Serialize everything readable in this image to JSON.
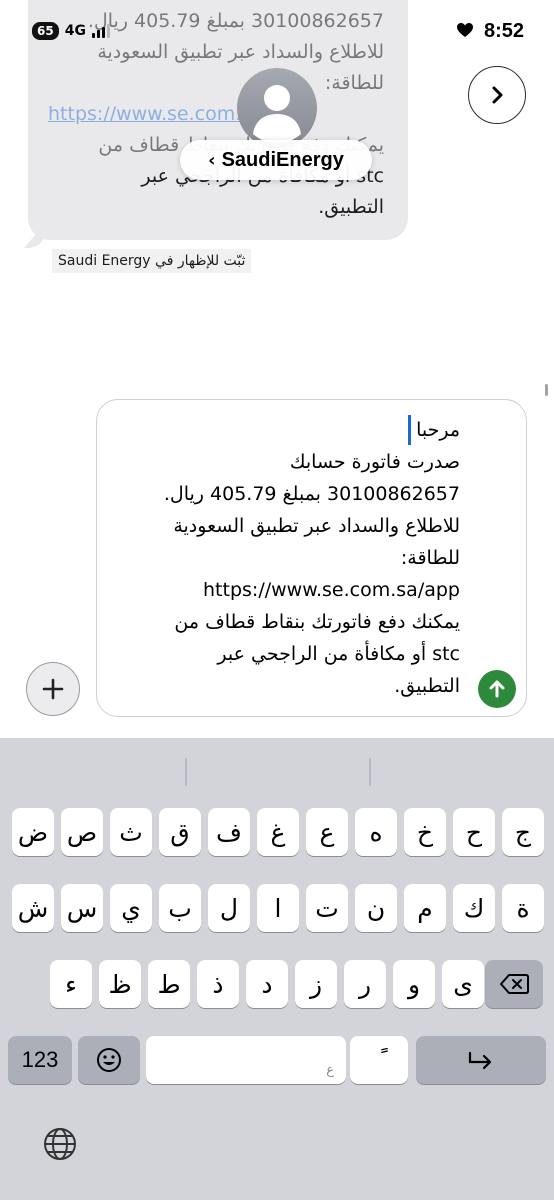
{
  "status": {
    "badge": "65",
    "network": "4G",
    "time": "8:52"
  },
  "received": {
    "lines": [
      "30100862657 بمبلغ 405.79 ريال.",
      "للاطلاع والسداد عبر تطبيق السعودية",
      "للطاقة:",
      "https://www.se.com.sa/app",
      "يمكنك دفع فاتورتك بنقاط قطاف من",
      "stc أو مكافأة من الراجحي عبر",
      "التطبيق."
    ]
  },
  "header": {
    "contact_name": "SaudiEnergy",
    "back_chevron": "‹"
  },
  "pin_caption": "ثبّت للإظهار في Saudi Energy",
  "compose": {
    "lines": [
      "مرحبا",
      "صدرت فاتورة حسابك",
      "30100862657 بمبلغ 405.79 ريال.",
      "للاطلاع والسداد عبر تطبيق السعودية",
      "للطاقة:",
      "https://www.se.com.sa/app",
      "يمكنك دفع فاتورتك بنقاط قطاف من",
      "stc أو مكافأة من الراجحي عبر",
      "التطبيق."
    ],
    "plus_label": "+"
  },
  "keyboard": {
    "row1": [
      "ج",
      "ح",
      "خ",
      "ه",
      "ع",
      "غ",
      "ف",
      "ق",
      "ث",
      "ص",
      "ض"
    ],
    "row2": [
      "ة",
      "ك",
      "م",
      "ن",
      "ت",
      "ا",
      "ل",
      "ب",
      "ي",
      "س",
      "ش"
    ],
    "row3": [
      "ى",
      "و",
      "ر",
      "ز",
      "د",
      "ذ",
      "ط",
      "ظ",
      "ء"
    ],
    "numbers_key": "123",
    "space_hint": "ع",
    "tanween_key": "ًً"
  },
  "icons": {
    "heart": "heart-icon",
    "next": "chevron-right-icon",
    "avatar": "person-icon",
    "send": "arrow-up-icon",
    "delete": "delete-icon",
    "return": "return-icon",
    "emoji": "emoji-icon",
    "globe": "globe-icon"
  },
  "colors": {
    "send_green": "#2d8a3d",
    "link_blue": "#1a6ad6",
    "bubble_gray": "#e9e9eb",
    "keyboard_bg": "#d2d4da"
  }
}
